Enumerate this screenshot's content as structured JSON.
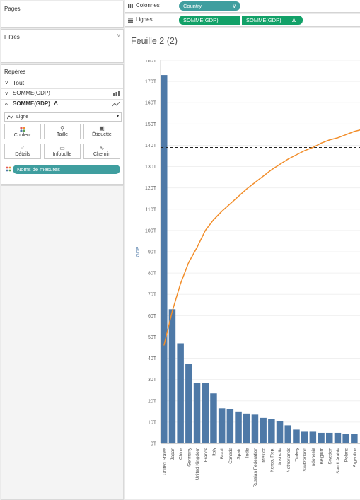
{
  "pages_panel": {
    "title": "Pages"
  },
  "filters_panel": {
    "title": "Filtres",
    "chevron": "˅"
  },
  "marks_panel": {
    "title": "Repères",
    "rows": [
      {
        "chev": "˅",
        "label": "Tout",
        "icon": ""
      },
      {
        "chev": "˅",
        "label": "SOMME(GDP)",
        "icon": "bar-chart-icon"
      },
      {
        "chev": "^",
        "label": "SOMME(GDP)",
        "delta": "Δ",
        "icon": "line-chart-icon"
      }
    ],
    "mark_type": "Ligne",
    "buttons": [
      {
        "label": "Couleur",
        "icon": "color-dots-icon"
      },
      {
        "label": "Taille",
        "icon": "size-icon"
      },
      {
        "label": "Étiquette",
        "icon": "label-icon"
      },
      {
        "label": "Détails",
        "icon": "detail-icon"
      },
      {
        "label": "Infobulle",
        "icon": "tooltip-icon"
      },
      {
        "label": "Chemin",
        "icon": "path-icon"
      }
    ],
    "measure_pill": "Noms de mesures"
  },
  "shelves": {
    "columns_label": "Colonnes",
    "columns_pill": "Country",
    "rows_label": "Lignes",
    "rows_pill1": "SOMME(GDP)",
    "rows_pill2": "SOMME(GDP)",
    "rows_pill2_delta": "Δ"
  },
  "sheet_title": "Feuille 2 (2)",
  "colors": {
    "bar": "#4e79a7",
    "line": "#f28e2b",
    "teal": "#3f9e9f",
    "green": "#12a168"
  },
  "chart_data": {
    "type": "bar",
    "ylabel": "GDP",
    "ylim": [
      0,
      180
    ],
    "y_unit": "T",
    "y_ticks": [
      "0T",
      "10T",
      "20T",
      "30T",
      "40T",
      "50T",
      "60T",
      "70T",
      "80T",
      "90T",
      "100T",
      "110T",
      "120T",
      "130T",
      "140T",
      "150T",
      "160T",
      "170T",
      "180T"
    ],
    "categories": [
      "United States",
      "Japan",
      "China",
      "Germany",
      "United Kingdom",
      "France",
      "Italy",
      "Brazil",
      "Canada",
      "Spain",
      "India",
      "Russian Federation",
      "Mexico",
      "Korea, Rep.",
      "Australia",
      "Netherlands",
      "Turkey",
      "Switzerland",
      "Indonesia",
      "Belgium",
      "Sweden",
      "Saudi Arabia",
      "Poland",
      "Argentina"
    ],
    "values": [
      173,
      63,
      47,
      37.5,
      28.5,
      28.5,
      23.5,
      16.5,
      16,
      15,
      14,
      13.5,
      12,
      11.5,
      10.5,
      8.5,
      6.5,
      5.5,
      5.5,
      5,
      5,
      5,
      4.5,
      4.5
    ],
    "cumulative_line": [
      46,
      62,
      75,
      85,
      92,
      100,
      105,
      109,
      112.5,
      116,
      119.5,
      122.5,
      125.5,
      128.5,
      131,
      133.5,
      135.5,
      137.5,
      139,
      141,
      142.5,
      143.5,
      145,
      146.5,
      147.5
    ],
    "reference_line": 139
  }
}
